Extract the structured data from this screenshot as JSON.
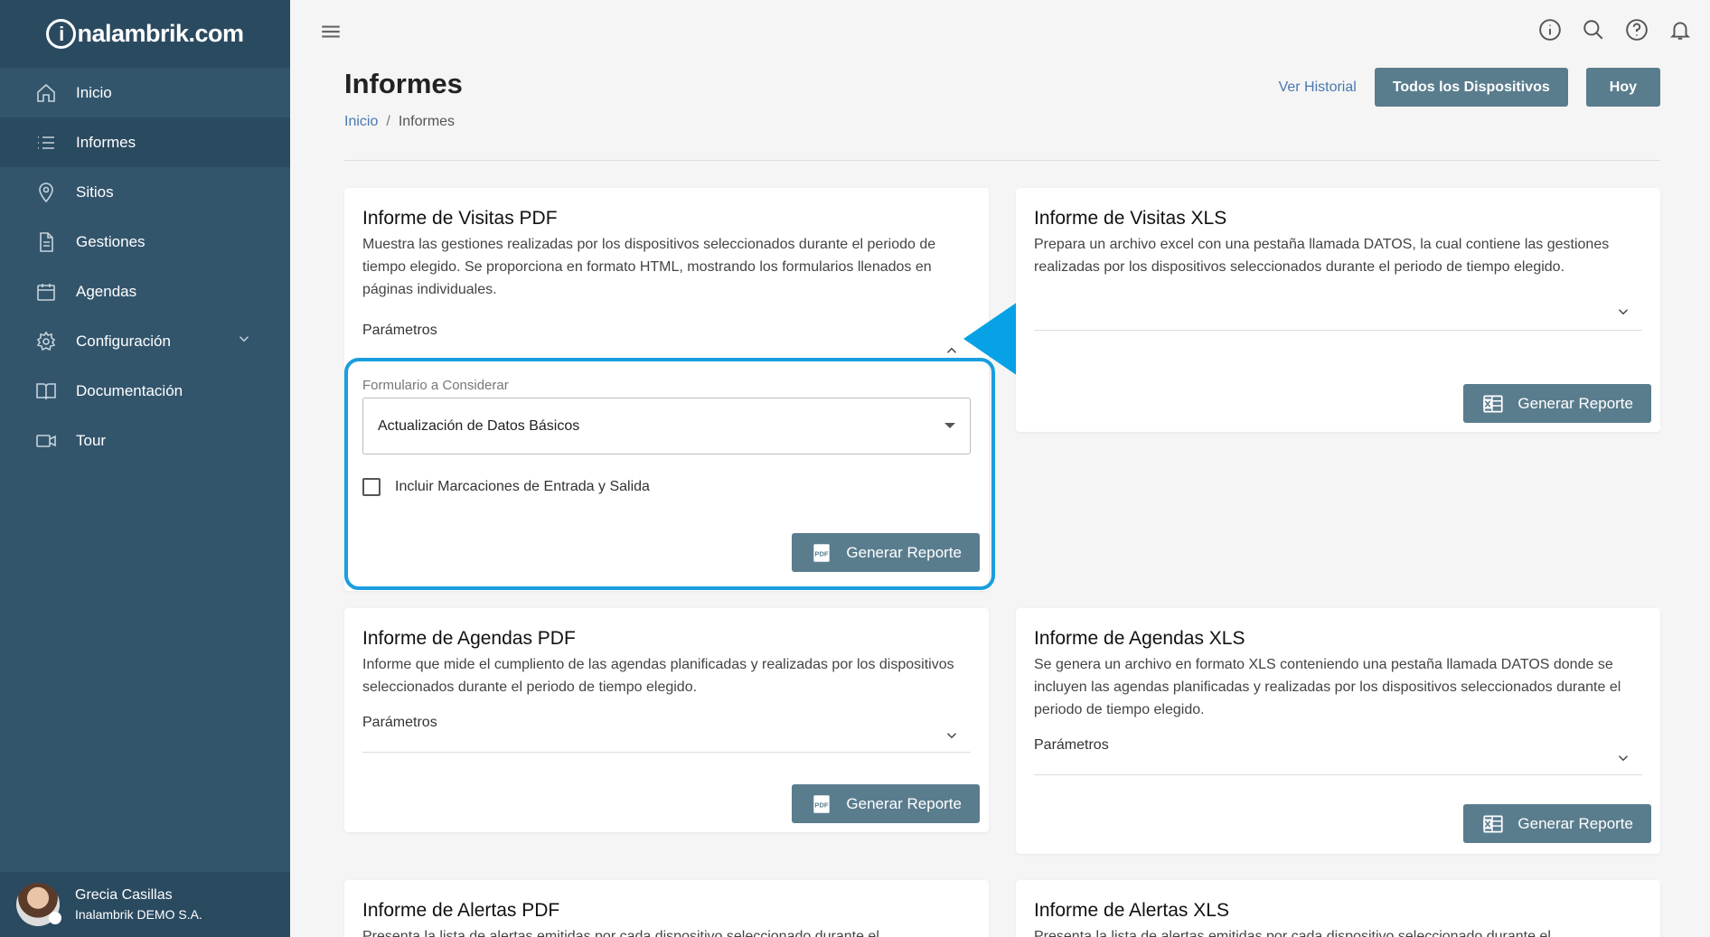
{
  "brand": {
    "prefix": "i",
    "name": "nalambrik.com"
  },
  "sidebar": {
    "items": [
      {
        "label": "Inicio",
        "icon": "home-icon"
      },
      {
        "label": "Informes",
        "icon": "list-icon"
      },
      {
        "label": "Sitios",
        "icon": "location-pin-icon"
      },
      {
        "label": "Gestiones",
        "icon": "document-icon"
      },
      {
        "label": "Agendas",
        "icon": "calendar-icon"
      },
      {
        "label": "Configuración",
        "icon": "gear-icon"
      },
      {
        "label": "Documentación",
        "icon": "book-icon"
      },
      {
        "label": "Tour",
        "icon": "video-icon"
      }
    ]
  },
  "user": {
    "name": "Grecia Casillas",
    "org": "Inalambrik DEMO S.A."
  },
  "header": {
    "title": "Informes",
    "breadcrumb": {
      "home": "Inicio",
      "current": "Informes"
    },
    "history_link": "Ver Historial",
    "devices_button": "Todos los Dispositivos",
    "today_button": "Hoy"
  },
  "cards": {
    "visitas_pdf": {
      "title": "Informe de Visitas PDF",
      "desc": "Muestra las gestiones realizadas por los dispositivos seleccionados durante el periodo de tiempo elegido. Se proporciona en formato HTML, mostrando los formularios llenados en páginas individuales.",
      "params_label": "Parámetros",
      "field_label": "Formulario a Considerar",
      "field_value": "Actualización de Datos Básicos",
      "checkbox_label": "Incluir Marcaciones de Entrada y Salida",
      "button": "Generar Reporte"
    },
    "visitas_xls": {
      "title": "Informe de Visitas XLS",
      "desc": "Prepara un archivo excel con una pestaña llamada DATOS, la cual contiene las gestiones realizadas por los dispositivos seleccionados durante el periodo de tiempo elegido.",
      "button": "Generar Reporte"
    },
    "agendas_pdf": {
      "title": "Informe de Agendas PDF",
      "desc": "Informe que mide el cumpliento de las agendas planificadas y realizadas por los dispositivos seleccionados durante el periodo de tiempo elegido.",
      "params_label": "Parámetros",
      "button": "Generar Reporte"
    },
    "agendas_xls": {
      "title": "Informe de Agendas XLS",
      "desc": "Se genera un archivo en formato XLS conteniendo una pestaña llamada DATOS donde se incluyen las agendas planificadas y realizadas por los dispositivos seleccionados durante el periodo de tiempo elegido.",
      "params_label": "Parámetros",
      "button": "Generar Reporte"
    },
    "alertas_pdf": {
      "title": "Informe de Alertas PDF",
      "desc": "Presenta la lista de alertas emitidas por cada dispositivo seleccionado durante el"
    },
    "alertas_xls": {
      "title": "Informe de Alertas XLS",
      "desc": "Presenta la lista de alertas emitidas por cada dispositivo seleccionado durante el"
    }
  },
  "colors": {
    "sidebar": "#33556c",
    "sidebar_dark": "#2a4a60",
    "button": "#5a7d8e",
    "highlight": "#1a9ede",
    "link": "#4a78b0"
  }
}
